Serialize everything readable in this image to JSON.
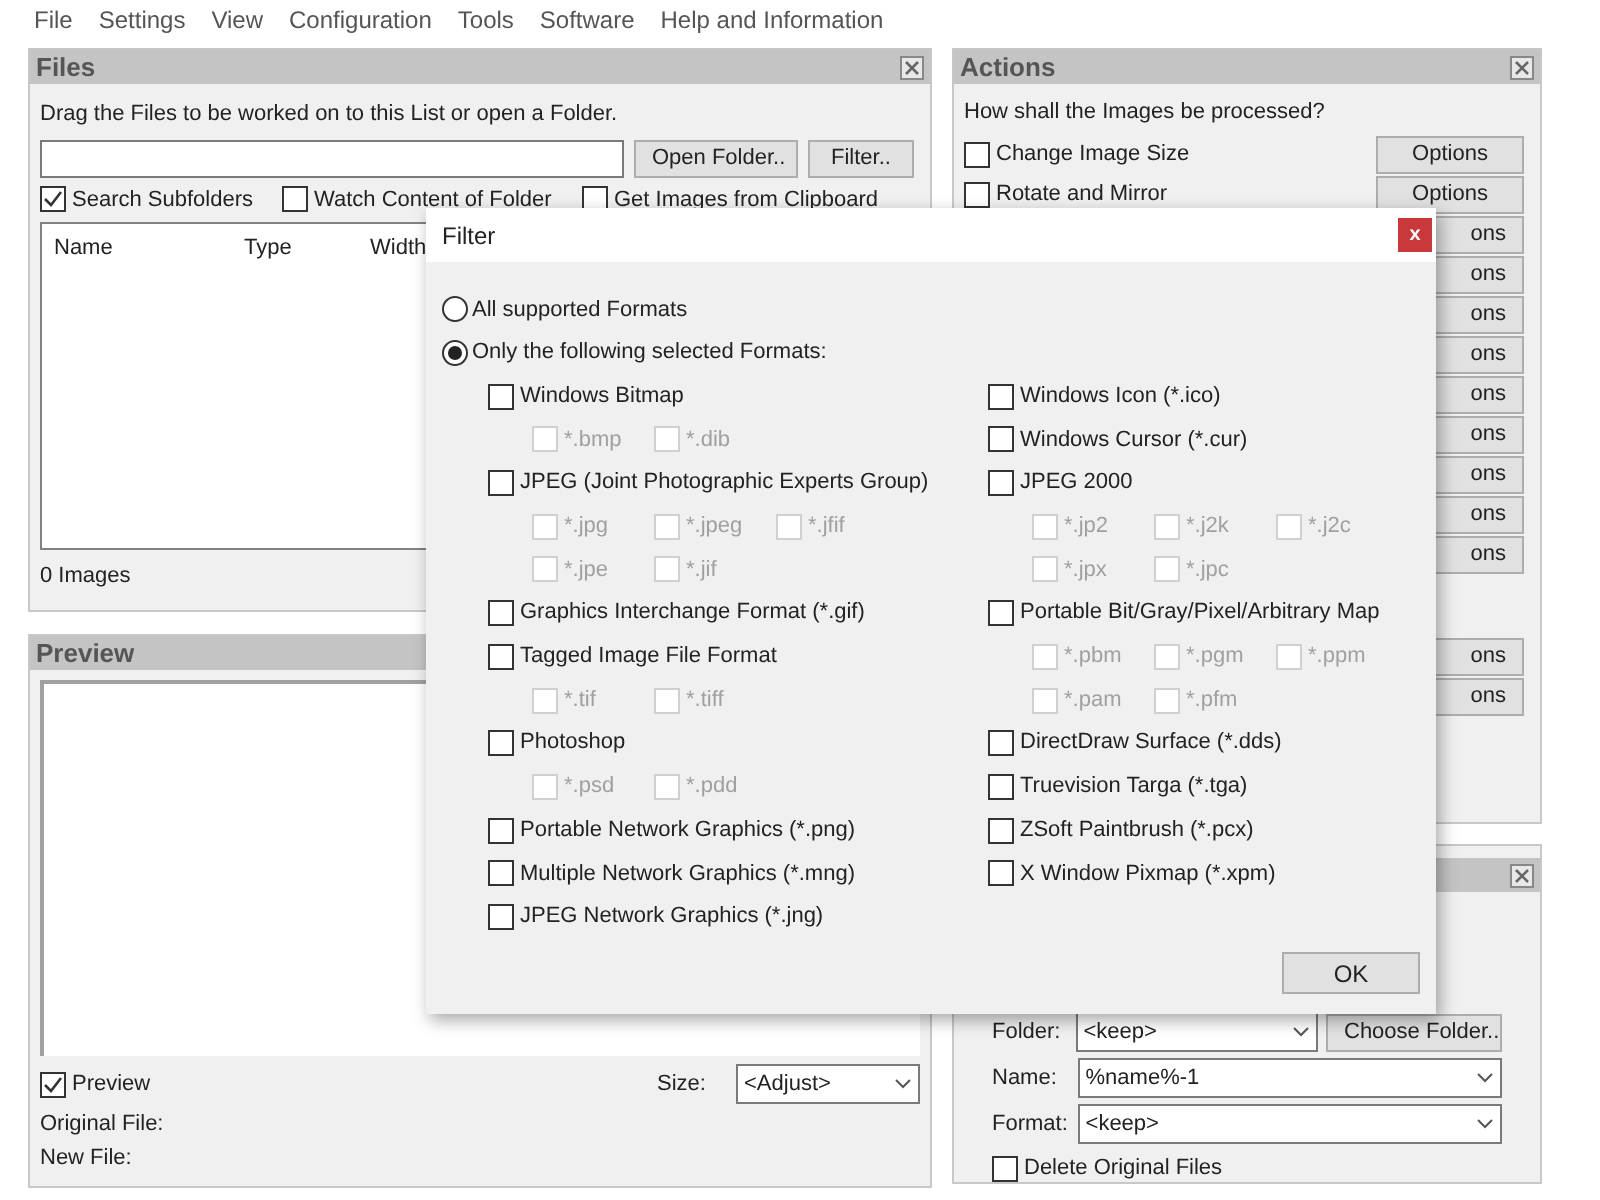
{
  "menu": [
    "File",
    "Settings",
    "View",
    "Configuration",
    "Tools",
    "Software",
    "Help and Information"
  ],
  "files": {
    "title": "Files",
    "hint": "Drag the Files to be worked on to this List or open a Folder.",
    "buttons": [
      "Open Folder..",
      "Filter.."
    ],
    "options": [
      {
        "label": "Search Subfolders",
        "checked": true
      },
      {
        "label": "Watch Content of Folder",
        "checked": false
      },
      {
        "label": "Get Images from Clipboard",
        "checked": false
      }
    ],
    "columns": [
      "Name",
      "Type",
      "Width"
    ],
    "count": "0 Images"
  },
  "preview": {
    "title": "Preview",
    "checkbox": {
      "label": "Preview",
      "checked": true
    },
    "size_label": "Size:",
    "size_value": "<Adjust>",
    "original_file": "Original File:",
    "new_file": "New File:"
  },
  "actions": {
    "title": "Actions",
    "question": "How shall the Images be processed?",
    "items": [
      {
        "label": "Change Image Size",
        "checked": false,
        "button": "Options"
      },
      {
        "label": "Rotate and Mirror",
        "checked": false,
        "button": "Options"
      },
      {
        "button": "ons"
      },
      {
        "button": "ons"
      },
      {
        "button": "ons"
      },
      {
        "button": "ons"
      },
      {
        "button": "ons"
      },
      {
        "button": "ons"
      },
      {
        "button": "ons"
      },
      {
        "button": "ons"
      },
      {
        "button": "ons"
      }
    ],
    "more_items": [
      {
        "button": "ons"
      },
      {
        "button": "ons"
      }
    ]
  },
  "output": {
    "fields": [
      {
        "label": "Folder:",
        "value": "<keep>",
        "button": "Choose Folder.."
      },
      {
        "label": "Name:",
        "value": "%name%-1"
      },
      {
        "label": "Format:",
        "value": "<keep>"
      }
    ],
    "delete": {
      "label": "Delete Original Files",
      "checked": false
    }
  },
  "dialog": {
    "title": "Filter",
    "close": "x",
    "modes": [
      {
        "label": "All supported Formats",
        "selected": false
      },
      {
        "label": "Only the following selected Formats:",
        "selected": true
      }
    ],
    "left": [
      {
        "label": "Windows Bitmap",
        "checked": false,
        "subs": [
          [
            {
              "label": "*.bmp",
              "checked": false,
              "disabled": true
            },
            {
              "label": "*.dib",
              "checked": false,
              "disabled": true
            }
          ]
        ]
      },
      {
        "label": "JPEG (Joint Photographic Experts Group)",
        "checked": false,
        "subs": [
          [
            {
              "label": "*.jpg",
              "checked": false,
              "disabled": true
            },
            {
              "label": "*.jpeg",
              "checked": false,
              "disabled": true
            },
            {
              "label": "*.jfif",
              "checked": false,
              "disabled": true
            }
          ],
          [
            {
              "label": "*.jpe",
              "checked": false,
              "disabled": true
            },
            {
              "label": "*.jif",
              "checked": false,
              "disabled": true
            }
          ]
        ]
      },
      {
        "label": "Graphics Interchange Format (*.gif)",
        "checked": false
      },
      {
        "label": "Tagged Image File Format",
        "checked": false,
        "subs": [
          [
            {
              "label": "*.tif",
              "checked": false,
              "disabled": true
            },
            {
              "label": "*.tiff",
              "checked": false,
              "disabled": true
            }
          ]
        ]
      },
      {
        "label": "Photoshop",
        "checked": false,
        "subs": [
          [
            {
              "label": "*.psd",
              "checked": false,
              "disabled": true
            },
            {
              "label": "*.pdd",
              "checked": false,
              "disabled": true
            }
          ]
        ]
      },
      {
        "label": "Portable Network Graphics (*.png)",
        "checked": false
      },
      {
        "label": "Multiple Network Graphics (*.mng)",
        "checked": false
      },
      {
        "label": "JPEG Network Graphics (*.jng)",
        "checked": false
      }
    ],
    "right": [
      {
        "label": "Windows Icon (*.ico)",
        "checked": false
      },
      {
        "label": "Windows Cursor (*.cur)",
        "checked": false
      },
      {
        "label": "JPEG 2000",
        "checked": false,
        "subs": [
          [
            {
              "label": "*.jp2",
              "checked": false,
              "disabled": true
            },
            {
              "label": "*.j2k",
              "checked": false,
              "disabled": true
            },
            {
              "label": "*.j2c",
              "checked": false,
              "disabled": true
            }
          ],
          [
            {
              "label": "*.jpx",
              "checked": false,
              "disabled": true
            },
            {
              "label": "*.jpc",
              "checked": false,
              "disabled": true
            }
          ]
        ]
      },
      {
        "label": "Portable Bit/Gray/Pixel/Arbitrary Map",
        "checked": false,
        "subs": [
          [
            {
              "label": "*.pbm",
              "checked": false,
              "disabled": true
            },
            {
              "label": "*.pgm",
              "checked": false,
              "disabled": true
            },
            {
              "label": "*.ppm",
              "checked": false,
              "disabled": true
            }
          ],
          [
            {
              "label": "*.pam",
              "checked": false,
              "disabled": true
            },
            {
              "label": "*.pfm",
              "checked": false,
              "disabled": true
            }
          ]
        ]
      },
      {
        "label": "DirectDraw Surface (*.dds)",
        "checked": false
      },
      {
        "label": "Truevision Targa (*.tga)",
        "checked": false
      },
      {
        "label": "ZSoft Paintbrush (*.pcx)",
        "checked": false
      },
      {
        "label": "X Window Pixmap (*.xpm)",
        "checked": false
      }
    ],
    "ok": "OK"
  }
}
